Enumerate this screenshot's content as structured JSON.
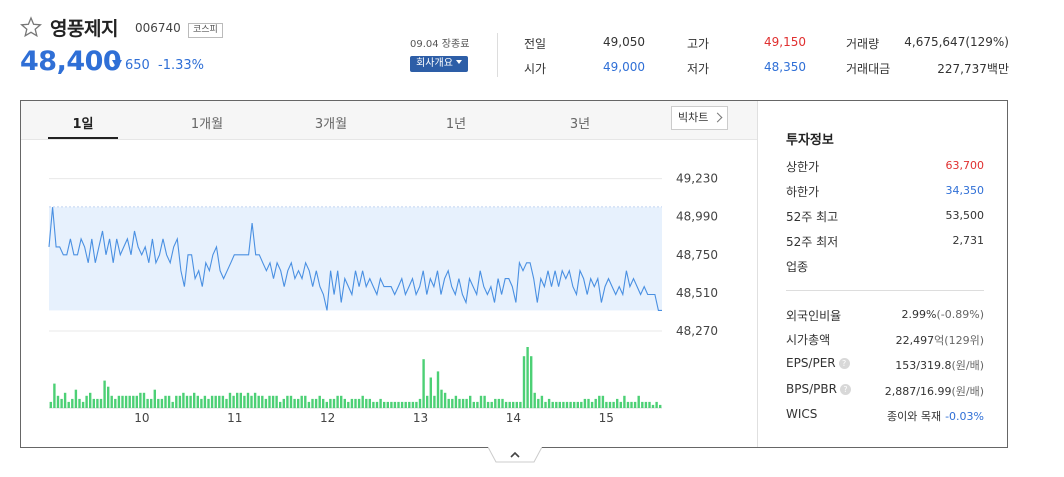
{
  "stock": {
    "name": "영풍제지",
    "code": "006740",
    "market": "코스피",
    "price": "48,400",
    "change": "650",
    "change_pct": "-1.33%",
    "date": "09.04 장종료",
    "company_info_btn": "회사개요"
  },
  "summary": [
    {
      "label": "전일",
      "value": "49,050",
      "color": "#333333"
    },
    {
      "label": "시가",
      "value": "49,000",
      "color": "#2f6fd6"
    },
    {
      "label": "고가",
      "value": "49,150",
      "color": "#e03030"
    },
    {
      "label": "저가",
      "value": "48,350",
      "color": "#2f6fd6"
    },
    {
      "label": "거래량",
      "value": "4,675,647(129%)",
      "color": "#333333"
    },
    {
      "label": "거래대금",
      "value": "227,737백만",
      "color": "#333333"
    }
  ],
  "tabs": [
    "1일",
    "1개월",
    "3개월",
    "1년",
    "3년"
  ],
  "active_tab": 0,
  "bigchart_label": "빅차트",
  "chart_data": {
    "type": "line",
    "ylim": [
      48220,
      49240
    ],
    "yticks": [
      "49,230",
      "48,990",
      "48,750",
      "48,510",
      "48,270"
    ],
    "ytick_values": [
      49230,
      48990,
      48750,
      48510,
      48270
    ],
    "ref_line": 49050,
    "xticks": [
      "10",
      "11",
      "12",
      "13",
      "14",
      "15"
    ],
    "xtick_positions": [
      10,
      11,
      12,
      13,
      14,
      15
    ],
    "x_range": [
      9,
      15.6
    ],
    "prices": [
      48800,
      49050,
      48800,
      48800,
      48750,
      48750,
      48850,
      48750,
      48750,
      48850,
      48800,
      48700,
      48850,
      48700,
      48800,
      48900,
      48750,
      48850,
      48700,
      48850,
      48750,
      48800,
      48850,
      48750,
      48900,
      48800,
      48750,
      48800,
      48700,
      48850,
      48700,
      48750,
      48850,
      48750,
      48700,
      48800,
      48850,
      48650,
      48550,
      48750,
      48750,
      48600,
      48650,
      48550,
      48700,
      48650,
      48750,
      48800,
      48650,
      48600,
      48650,
      48700,
      48750,
      48750,
      48750,
      48750,
      48750,
      48950,
      48750,
      48750,
      48700,
      48650,
      48700,
      48600,
      48700,
      48650,
      48550,
      48650,
      48700,
      48600,
      48650,
      48600,
      48700,
      48650,
      48550,
      48650,
      48550,
      48500,
      48400,
      48650,
      48500,
      48650,
      48450,
      48600,
      48550,
      48500,
      48650,
      48550,
      48650,
      48550,
      48600,
      48550,
      48500,
      48600,
      48550,
      48550,
      48550,
      48500,
      48550,
      48600,
      48500,
      48550,
      48600,
      48500,
      48550,
      48650,
      48500,
      48600,
      48550,
      48650,
      48500,
      48600,
      48650,
      48550,
      48500,
      48600,
      48500,
      48450,
      48600,
      48550,
      48500,
      48650,
      48550,
      48500,
      48550,
      48450,
      48600,
      48500,
      48600,
      48600,
      48550,
      48450,
      48700,
      48650,
      48700,
      48700,
      48600,
      48450,
      48600,
      48550,
      48650,
      48550,
      48650,
      48550,
      48650,
      48600,
      48650,
      48550,
      48500,
      48650,
      48600,
      48500,
      48600,
      48550,
      48600,
      48450,
      48550,
      48600,
      48550,
      48500,
      48550,
      48500,
      48650,
      48550,
      48600,
      48550,
      48500,
      48550,
      48500,
      48500,
      48500,
      48400,
      48400
    ],
    "volumes": [
      2,
      8,
      4,
      3,
      5,
      2,
      3,
      6,
      3,
      2,
      4,
      5,
      3,
      3,
      3,
      9,
      7,
      4,
      3,
      4,
      4,
      4,
      4,
      4,
      4,
      5,
      5,
      3,
      3,
      6,
      3,
      3,
      4,
      4,
      2,
      4,
      4,
      5,
      4,
      4,
      5,
      4,
      3,
      4,
      3,
      4,
      4,
      4,
      4,
      3,
      5,
      4,
      5,
      5,
      4,
      5,
      4,
      5,
      4,
      4,
      3,
      4,
      4,
      4,
      2,
      3,
      4,
      4,
      3,
      3,
      4,
      4,
      2,
      3,
      3,
      4,
      3,
      2,
      3,
      3,
      4,
      4,
      3,
      2,
      3,
      3,
      3,
      4,
      3,
      3,
      2,
      2,
      3,
      2,
      2,
      2,
      2,
      2,
      2,
      2,
      2,
      2,
      2,
      3,
      16,
      4,
      10,
      4,
      12,
      6,
      5,
      3,
      3,
      4,
      3,
      3,
      3,
      4,
      2,
      2,
      4,
      4,
      2,
      2,
      3,
      3,
      3,
      2,
      2,
      2,
      2,
      2,
      17,
      20,
      17,
      5,
      3,
      4,
      2,
      3,
      2,
      2,
      2,
      2,
      2,
      2,
      2,
      2,
      2,
      3,
      3,
      2,
      3,
      4,
      4,
      2,
      2,
      2,
      3,
      2,
      4,
      2,
      2,
      2,
      4,
      2,
      2,
      2,
      1,
      2,
      1
    ],
    "line_color": "#4a90e2",
    "fill_color": "#e7f1fd",
    "volume_color": "#4cd075"
  },
  "invest": {
    "title": "투자정보",
    "group1": [
      {
        "label": "상한가",
        "value": "63,700",
        "color": "#e03030"
      },
      {
        "label": "하한가",
        "value": "34,350",
        "color": "#2f6fd6"
      },
      {
        "label": "52주 최고",
        "value": "53,500",
        "color": "#333333"
      },
      {
        "label": "52주 최저",
        "value": "2,731",
        "color": "#333333"
      },
      {
        "label": "업종",
        "value": "",
        "color": "#333333"
      }
    ],
    "group2": [
      {
        "label": "외국인비율",
        "value": "2.99%",
        "extra": "(-0.89%)",
        "color": "#333333",
        "extra_color": "#666666",
        "help": false
      },
      {
        "label": "시가총액",
        "value": "22,497",
        "extra": "억(129위)",
        "color": "#333333",
        "extra_color": "#666666",
        "help": false
      },
      {
        "label": "EPS/PER",
        "value": "153/319.8",
        "extra": "(원/배)",
        "color": "#333333",
        "extra_color": "#666666",
        "help": true
      },
      {
        "label": "BPS/PBR",
        "value": "2,887/16.99",
        "extra": "(원/배)",
        "color": "#333333",
        "extra_color": "#666666",
        "help": true
      },
      {
        "label": "WICS",
        "value": "종이와 목재",
        "extra": "-0.03%",
        "color": "#333333",
        "extra_color": "#2f6fd6",
        "help": false
      }
    ],
    "help_glyph": "?"
  }
}
